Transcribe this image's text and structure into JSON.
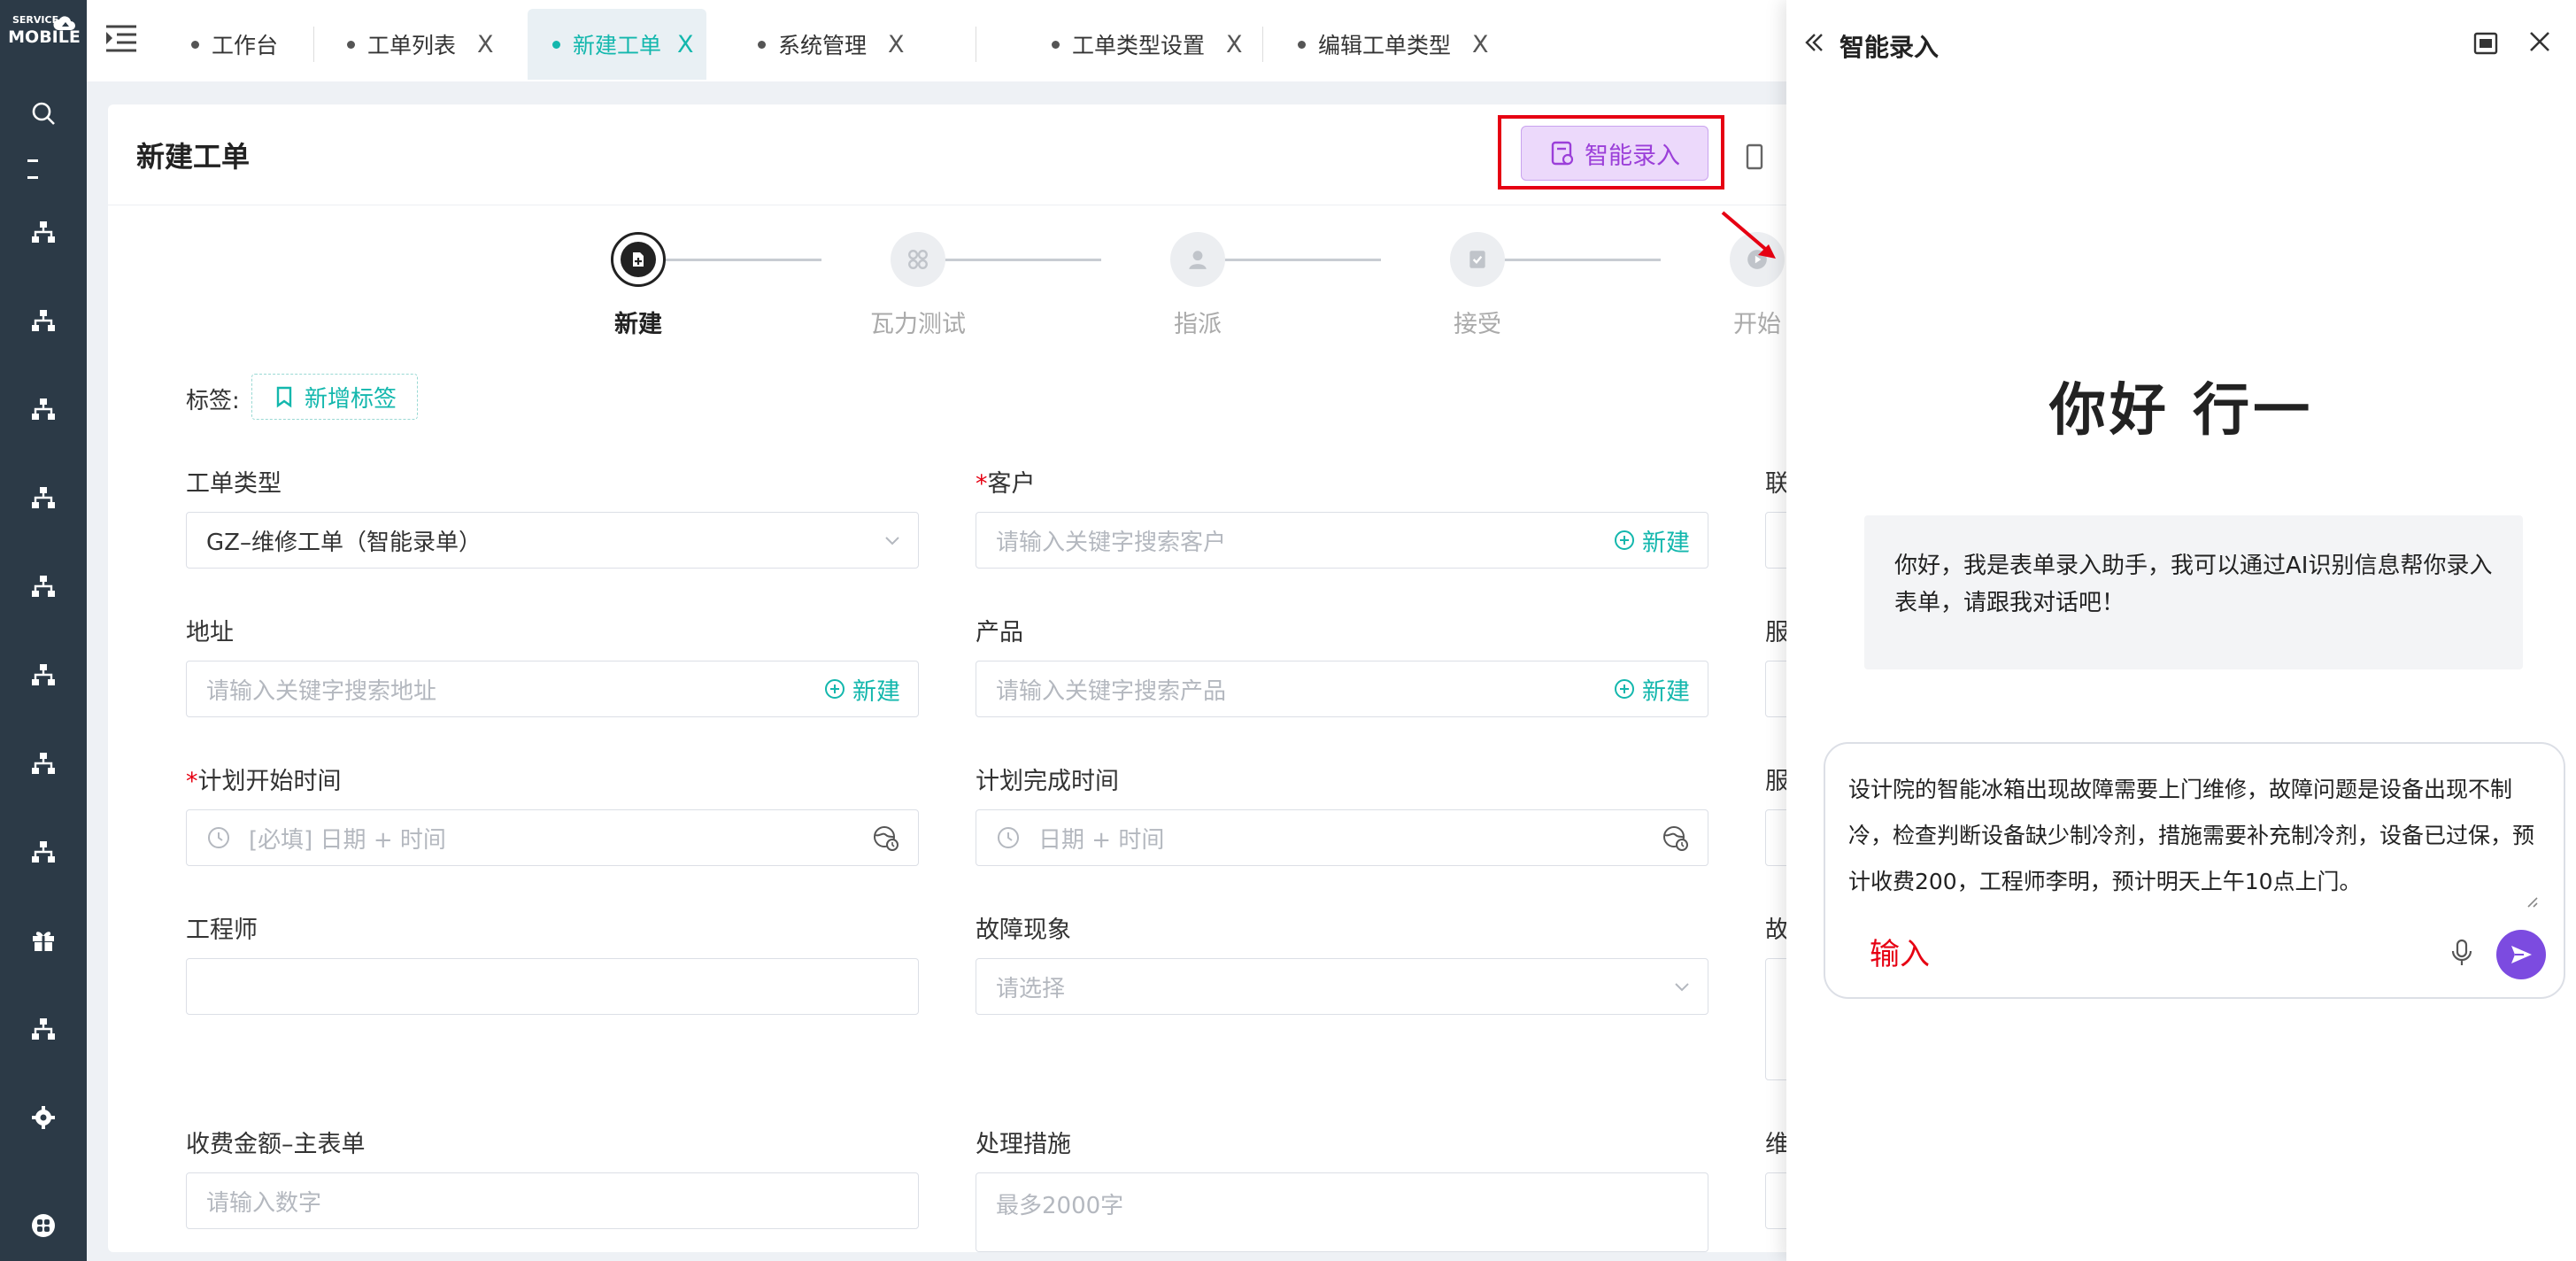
{
  "app": {
    "logo_top": "SERVICE",
    "logo_bottom": "MOBILE"
  },
  "sidebar": {
    "items": [
      {
        "icon": "search-icon"
      },
      {
        "icon": "org-chart-icon"
      },
      {
        "icon": "org-chart-icon"
      },
      {
        "icon": "org-chart-icon"
      },
      {
        "icon": "org-chart-icon"
      },
      {
        "icon": "org-chart-icon"
      },
      {
        "icon": "org-chart-icon"
      },
      {
        "icon": "org-chart-icon"
      },
      {
        "icon": "org-chart-icon"
      },
      {
        "icon": "gift-icon"
      },
      {
        "icon": "org-chart-icon"
      },
      {
        "icon": "settings-icon"
      },
      {
        "icon": "apps-icon"
      }
    ]
  },
  "tabs": [
    {
      "label": "工作台",
      "closable": false,
      "active": false
    },
    {
      "label": "工单列表",
      "closable": true,
      "active": false
    },
    {
      "label": "新建工单",
      "closable": true,
      "active": true
    },
    {
      "label": "系统管理",
      "closable": true,
      "active": false
    },
    {
      "label": "工单类型设置",
      "closable": true,
      "active": false
    },
    {
      "label": "编辑工单类型",
      "closable": true,
      "active": false
    }
  ],
  "tab_close_glyph": "X",
  "page": {
    "title": "新建工单",
    "ai_button": "智能录入"
  },
  "steps": [
    {
      "label": "新建",
      "active": true
    },
    {
      "label": "瓦力测试",
      "active": false
    },
    {
      "label": "指派",
      "active": false
    },
    {
      "label": "接受",
      "active": false
    },
    {
      "label": "开始",
      "active": false
    }
  ],
  "tags": {
    "label": "标签:",
    "add_button": "新增标签"
  },
  "form": {
    "ticket_type": {
      "label": "工单类型",
      "value": "GZ–维修工单（智能录单）"
    },
    "customer": {
      "label": "客户",
      "required": "*",
      "placeholder": "请输入关键字搜索客户",
      "new": "新建"
    },
    "contact_label": "联",
    "address": {
      "label": "地址",
      "placeholder": "请输入关键字搜索地址",
      "new": "新建"
    },
    "product": {
      "label": "产品",
      "placeholder": "请输入关键字搜索产品",
      "new": "新建"
    },
    "service1_label": "服",
    "plan_start": {
      "label": "计划开始时间",
      "required": "*",
      "placeholder": "[必填] 日期 + 时间"
    },
    "plan_end": {
      "label": "计划完成时间",
      "placeholder": "日期 + 时间"
    },
    "service2_label": "服",
    "engineer": {
      "label": "工程师",
      "value": ""
    },
    "fault": {
      "label": "故障现象",
      "placeholder": "请选择"
    },
    "fault2_label": "故",
    "fee": {
      "label": "收费金额–主表单",
      "placeholder": "请输入数字"
    },
    "measures": {
      "label": "处理措施",
      "placeholder": "最多2000字"
    },
    "maint_label": "维"
  },
  "panel": {
    "title": "智能录入",
    "greeting": "你好 行一",
    "bot_message": "你好，我是表单录入助手，我可以通过AI识别信息帮你录入表单，请跟我对话吧！",
    "user_input": "设计院的智能冰箱出现故障需要上门维修，故障问题是设备出现不制冷，检查判断设备缺少制冷剂，措施需要补充制冷剂，设备已过保，预计收费200，工程师李明，预计明天上午10点上门。",
    "input_hint": "输入"
  },
  "colors": {
    "accent": "#13b7ad",
    "sidebar_bg": "#2c3a47",
    "ai_purple": "#9b3fd9",
    "highlight_red": "#e60012",
    "send_purple": "#7c4be0"
  }
}
